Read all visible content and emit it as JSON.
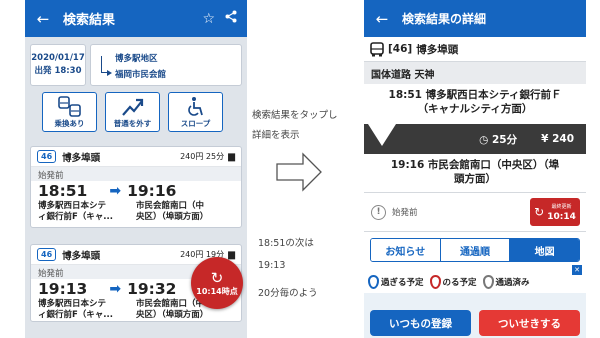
{
  "left": {
    "title": "検索結果",
    "back_icon": "arrow-left-icon",
    "date": "2020/01/17",
    "departure": "出発 18:30",
    "from": "博多駅地区",
    "to": "福岡市民会館",
    "options": [
      {
        "label": "乗換あり",
        "icon": "bus-transfer-icon"
      },
      {
        "label": "普通を外す",
        "icon": "trend-up-icon"
      },
      {
        "label": "スロープ",
        "icon": "wheelchair-icon"
      }
    ],
    "results": [
      {
        "route_no": "46",
        "route_name": "博多埠頭",
        "fare": "240円 25分",
        "status": "始発前",
        "dep_time": "18:51",
        "arr_time": "19:16",
        "from_stop_1": "博多駅西日本シテ",
        "from_stop_2": "ィ銀行前F（キャ...",
        "to_stop_1": "市民会館南口（中",
        "to_stop_2": "央区）（埠頭方面）"
      },
      {
        "route_no": "46",
        "route_name": "博多埠頭",
        "fare": "240円 19分",
        "status": "始発前",
        "dep_time": "19:13",
        "arr_time": "19:32",
        "from_stop_1": "博多駅西日本シテ",
        "from_stop_2": "ィ銀行前F（キャ...",
        "to_stop_1": "市民会館南口（中",
        "to_stop_2": "央区）（埠頭方面）"
      }
    ],
    "fab_time": "10:14時点"
  },
  "notes": {
    "tap_line1": "検索結果をタップし",
    "tap_line2": "詳細を表示",
    "next_line1": "18:51の次は",
    "next_line2": "19:13",
    "next_line3": "20分毎のよう"
  },
  "right": {
    "title": "検索結果の詳細",
    "route_no": "[46]",
    "route_name": "博多埠頭",
    "section": "国体道路 天神",
    "dep_line1": "18:51 博多駅西日本シティ銀行前Ｆ",
    "dep_line2": "（キャナルシティ方面）",
    "duration": "25分",
    "fare": "240",
    "arr_line1": "19:16 市民会館南口（中央区）（埠",
    "arr_line2": "頭方面）",
    "status": "始発前",
    "update_label": "最終更新",
    "update_time": "10:14",
    "tabs": [
      "お知らせ",
      "通過順",
      "地図"
    ],
    "legend": [
      "過ぎる予定",
      "のる予定",
      "通過済み"
    ],
    "button_regular": "いつもの登録",
    "button_follow": "ついせきする"
  },
  "colors": {
    "primary": "#1565c0",
    "accent_red": "#c62828",
    "follow_red": "#e53935"
  }
}
